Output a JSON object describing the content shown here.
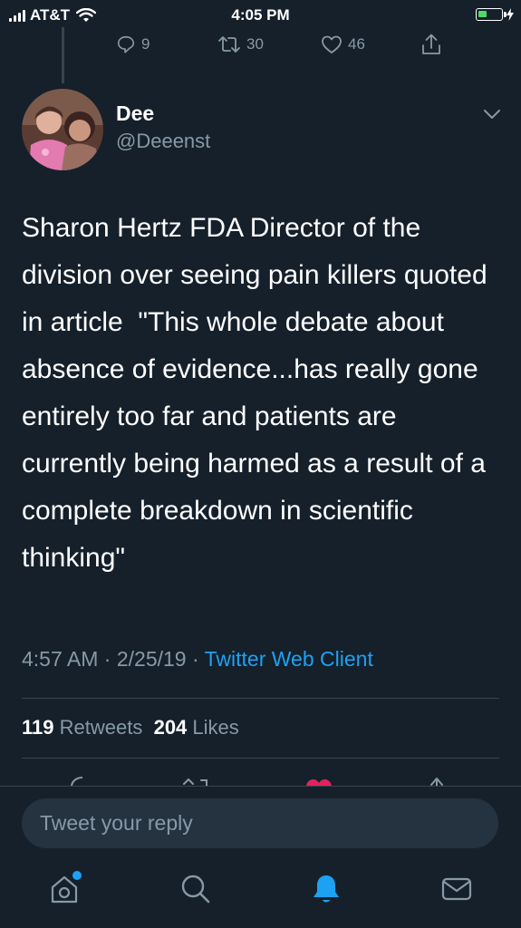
{
  "status_bar": {
    "carrier": "AT&T",
    "time": "4:05 PM"
  },
  "previous_tweet_actions": {
    "replies": "9",
    "retweets": "30",
    "likes": "46"
  },
  "tweet": {
    "name": "Dee",
    "handle": "@Deeenst",
    "text": "Sharon Hertz FDA Director of the division over seeing pain killers quoted in article  \"This whole debate about absence of evidence...has really gone entirely too far and patients are currently being harmed as a result of a complete breakdown in scientific thinking\"",
    "time": "4:57 AM",
    "date": "2/25/19",
    "separator": "·",
    "client": "Twitter Web Client",
    "retweet_count": "119",
    "retweet_label": "Retweets",
    "like_count": "204",
    "like_label": "Likes"
  },
  "reply_box": {
    "placeholder": "Tweet your reply"
  },
  "colors": {
    "background": "#15202b",
    "accent": "#1da1f2",
    "muted": "#8899a6",
    "like": "#e0245e",
    "divider": "#38444d"
  },
  "icons": [
    "signal-icon",
    "wifi-icon",
    "battery-icon",
    "reply-icon",
    "retweet-icon",
    "like-icon",
    "share-icon",
    "chevron-down-icon",
    "home-icon",
    "search-icon",
    "notifications-icon",
    "messages-icon"
  ]
}
